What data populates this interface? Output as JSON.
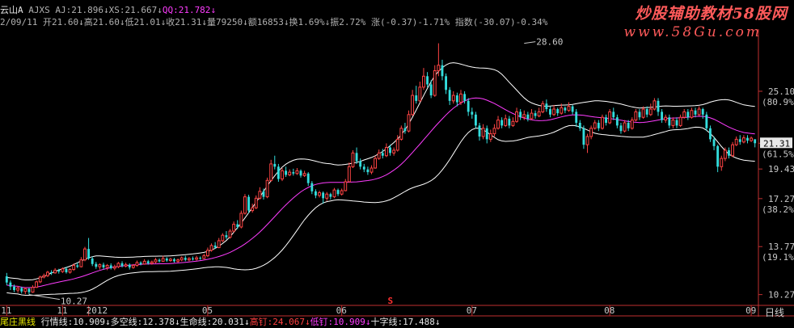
{
  "header": {
    "line1": [
      {
        "t": "云山A",
        "c": "c-white"
      },
      {
        "t": " AJXS AJ:21.896",
        "c": "c-grey"
      },
      {
        "t": "↓",
        "c": "c-grey"
      },
      {
        "t": "XS:21.667",
        "c": "c-grey"
      },
      {
        "t": "↓",
        "c": "c-grey"
      },
      {
        "t": "QQ:21.782",
        "c": "c-magenta"
      },
      {
        "t": "↓",
        "c": "c-magenta"
      }
    ],
    "line2": [
      {
        "t": "2/09/11 ",
        "c": "c-grey"
      },
      {
        "t": "开21.60",
        "c": "c-grey"
      },
      {
        "t": "↓",
        "c": "c-grey"
      },
      {
        "t": "高21.60",
        "c": "c-grey"
      },
      {
        "t": "↓",
        "c": "c-grey"
      },
      {
        "t": "低21.01",
        "c": "c-grey"
      },
      {
        "t": "↓",
        "c": "c-grey"
      },
      {
        "t": "收21.31",
        "c": "c-grey"
      },
      {
        "t": "↓",
        "c": "c-grey"
      },
      {
        "t": "量79250",
        "c": "c-grey"
      },
      {
        "t": "↓",
        "c": "c-grey"
      },
      {
        "t": "额16853",
        "c": "c-grey"
      },
      {
        "t": "↓",
        "c": "c-grey"
      },
      {
        "t": "换1.69%",
        "c": "c-grey"
      },
      {
        "t": "↓",
        "c": "c-grey"
      },
      {
        "t": "振2.72%",
        "c": "c-grey"
      },
      {
        "t": " 涨(-0.37)-1.71%",
        "c": "c-grey"
      },
      {
        "t": " 指数(-30.07)-0.34%",
        "c": "c-grey"
      }
    ]
  },
  "brand": {
    "title": "炒股辅助教材58股网",
    "url": "www.58Gu.com"
  },
  "period_label": "日线",
  "bottom_bar": [
    {
      "t": "尾庄黑线 ",
      "c": "c-yellow"
    },
    {
      "t": "行情线:10.909",
      "c": "c-white"
    },
    {
      "t": "↓",
      "c": "c-white"
    },
    {
      "t": "多空线:12.378",
      "c": "c-white"
    },
    {
      "t": "↓",
      "c": "c-white"
    },
    {
      "t": "生命线:20.031",
      "c": "c-white"
    },
    {
      "t": "↓",
      "c": "c-white"
    },
    {
      "t": "高钉:24.067",
      "c": "c-red"
    },
    {
      "t": "↓",
      "c": "c-red"
    },
    {
      "t": "低钉:10.909",
      "c": "c-magenta"
    },
    {
      "t": "↓",
      "c": "c-magenta"
    },
    {
      "t": "十字线:17.488",
      "c": "c-white"
    },
    {
      "t": "↓",
      "c": "c-white"
    }
  ],
  "colors": {
    "up": "#ff4444",
    "down": "#33dddd",
    "axis": "#c03030",
    "upper_band": "#ffffff",
    "lower_band": "#ffffff",
    "middle_band": "#ff3cff",
    "label": "#c8c8c8"
  },
  "chart_data": {
    "type": "candlestick",
    "ylim": [
      9.6,
      29.4
    ],
    "y_ticks": [
      {
        "v": 25.1,
        "label": "25.10",
        "pct": "(80.9%)"
      },
      {
        "v": 21.31,
        "label": "21.31",
        "pct": "(61.5%)",
        "current": true
      },
      {
        "v": 19.43,
        "label": "19.43",
        "pct": ""
      },
      {
        "v": 17.27,
        "label": "17.27",
        "pct": "(38.2%)"
      },
      {
        "v": 13.77,
        "label": "13.77",
        "pct": "(19.1%)"
      },
      {
        "v": 10.27,
        "label": "10.27",
        "pct": ""
      }
    ],
    "x_labels": [
      {
        "label": "11",
        "i": 0
      },
      {
        "label": "11",
        "i": 15
      },
      {
        "label": "2012",
        "i": 22
      },
      {
        "label": "05",
        "i": 54
      },
      {
        "label": "06",
        "i": 90
      },
      {
        "label": "07",
        "i": 125
      },
      {
        "label": "08",
        "i": 162
      },
      {
        "label": "09",
        "i": 200
      }
    ],
    "annotations": [
      {
        "label": "28.60",
        "i": 139,
        "price": 28.6,
        "kind": "high"
      },
      {
        "label": "10.27",
        "i": 6,
        "price": 10.27,
        "kind": "low"
      }
    ],
    "marker": {
      "label": "S",
      "i": 103
    },
    "candles": [
      [
        11.6,
        11.15,
        11.85,
        10.95
      ],
      [
        11.15,
        10.85,
        11.3,
        10.6
      ],
      [
        10.85,
        10.6,
        11.0,
        10.45
      ],
      [
        10.6,
        10.75,
        10.9,
        10.4
      ],
      [
        10.75,
        10.5,
        10.85,
        10.35
      ],
      [
        10.5,
        10.7,
        10.8,
        10.3
      ],
      [
        10.7,
        10.45,
        10.75,
        10.27
      ],
      [
        10.45,
        10.8,
        10.95,
        10.4
      ],
      [
        10.8,
        11.2,
        11.3,
        10.75
      ],
      [
        11.2,
        11.55,
        11.65,
        11.1
      ],
      [
        11.55,
        11.65,
        11.8,
        11.45
      ],
      [
        11.65,
        11.9,
        12.0,
        11.55
      ],
      [
        11.9,
        11.85,
        12.05,
        11.7
      ],
      [
        11.85,
        12.05,
        12.2,
        11.8
      ],
      [
        12.05,
        11.95,
        12.15,
        11.8
      ],
      [
        11.95,
        12.15,
        12.25,
        11.85
      ],
      [
        12.15,
        11.9,
        12.3,
        11.8
      ],
      [
        11.9,
        12.1,
        12.2,
        11.8
      ],
      [
        12.1,
        12.4,
        12.55,
        12.0
      ],
      [
        12.4,
        12.3,
        12.6,
        12.2
      ],
      [
        12.3,
        12.8,
        13.0,
        12.25
      ],
      [
        12.8,
        13.6,
        13.75,
        12.7
      ],
      [
        13.6,
        12.9,
        14.4,
        12.8
      ],
      [
        12.9,
        12.5,
        13.05,
        12.35
      ],
      [
        12.5,
        12.3,
        12.65,
        12.15
      ],
      [
        12.3,
        12.45,
        12.55,
        12.1
      ],
      [
        12.45,
        12.25,
        12.6,
        12.1
      ],
      [
        12.25,
        12.4,
        12.5,
        12.05
      ],
      [
        12.4,
        12.2,
        12.55,
        12.1
      ],
      [
        12.2,
        12.3,
        12.45,
        12.05
      ],
      [
        12.3,
        12.55,
        12.65,
        12.2
      ],
      [
        12.55,
        12.35,
        12.7,
        12.25
      ],
      [
        12.35,
        12.45,
        12.6,
        12.25
      ],
      [
        12.45,
        12.25,
        12.55,
        12.1
      ],
      [
        12.25,
        12.4,
        12.5,
        12.15
      ],
      [
        12.4,
        12.6,
        12.75,
        12.3
      ],
      [
        12.6,
        12.5,
        12.7,
        12.4
      ],
      [
        12.5,
        12.7,
        12.85,
        12.45
      ],
      [
        12.7,
        12.55,
        12.8,
        12.45
      ],
      [
        12.55,
        12.65,
        12.75,
        12.45
      ],
      [
        12.65,
        12.8,
        12.95,
        12.55
      ],
      [
        12.8,
        12.7,
        12.9,
        12.6
      ],
      [
        12.7,
        12.9,
        13.1,
        12.65
      ],
      [
        12.9,
        12.75,
        13.0,
        12.65
      ],
      [
        12.75,
        12.85,
        12.95,
        12.65
      ],
      [
        12.85,
        12.7,
        12.95,
        12.6
      ],
      [
        12.7,
        12.8,
        12.9,
        12.6
      ],
      [
        12.8,
        12.95,
        13.05,
        12.7
      ],
      [
        12.95,
        12.8,
        13.1,
        12.7
      ],
      [
        12.8,
        12.9,
        13.0,
        12.7
      ],
      [
        12.9,
        12.85,
        13.05,
        12.75
      ],
      [
        12.85,
        12.95,
        13.1,
        12.75
      ],
      [
        12.95,
        12.9,
        13.05,
        12.8
      ],
      [
        12.9,
        13.1,
        13.25,
        12.85
      ],
      [
        13.1,
        13.5,
        13.7,
        13.0
      ],
      [
        13.5,
        13.85,
        14.0,
        13.4
      ],
      [
        13.85,
        13.7,
        14.1,
        13.6
      ],
      [
        13.7,
        14.2,
        14.4,
        13.65
      ],
      [
        14.2,
        14.6,
        14.75,
        14.1
      ],
      [
        14.6,
        14.45,
        14.9,
        14.3
      ],
      [
        14.45,
        14.9,
        15.05,
        14.35
      ],
      [
        14.9,
        15.4,
        15.6,
        14.8
      ],
      [
        15.4,
        15.2,
        15.7,
        15.05
      ],
      [
        15.2,
        16.2,
        16.4,
        15.1
      ],
      [
        16.2,
        17.4,
        17.6,
        16.1
      ],
      [
        17.4,
        16.4,
        17.55,
        16.2
      ],
      [
        16.4,
        16.6,
        16.9,
        16.25
      ],
      [
        16.6,
        17.3,
        17.5,
        16.5
      ],
      [
        17.3,
        17.8,
        18.1,
        17.2
      ],
      [
        17.8,
        17.4,
        18.0,
        17.2
      ],
      [
        17.4,
        18.6,
        18.8,
        17.3
      ],
      [
        18.6,
        19.8,
        20.1,
        18.5
      ],
      [
        19.8,
        19.6,
        20.4,
        19.4
      ],
      [
        19.6,
        18.7,
        19.8,
        18.5
      ],
      [
        18.7,
        19.3,
        19.5,
        18.55
      ],
      [
        19.3,
        19.0,
        19.6,
        18.85
      ],
      [
        19.0,
        19.2,
        19.4,
        18.9
      ],
      [
        19.2,
        19.1,
        19.45,
        18.95
      ],
      [
        19.1,
        19.3,
        19.5,
        19.0
      ],
      [
        19.3,
        18.95,
        19.4,
        18.8
      ],
      [
        18.95,
        19.1,
        19.3,
        18.85
      ],
      [
        19.1,
        18.4,
        19.2,
        18.2
      ],
      [
        18.4,
        17.8,
        18.55,
        17.6
      ],
      [
        17.8,
        17.5,
        17.95,
        17.3
      ],
      [
        17.5,
        17.7,
        17.85,
        17.35
      ],
      [
        17.7,
        17.3,
        17.8,
        16.9
      ],
      [
        17.3,
        17.6,
        17.75,
        17.1
      ],
      [
        17.6,
        17.4,
        17.7,
        17.2
      ],
      [
        17.4,
        17.9,
        18.05,
        17.3
      ],
      [
        17.9,
        17.6,
        18.0,
        17.45
      ],
      [
        17.6,
        17.85,
        18.0,
        17.5
      ],
      [
        17.85,
        18.5,
        18.7,
        17.8
      ],
      [
        18.5,
        19.6,
        19.9,
        18.45
      ],
      [
        19.6,
        20.6,
        20.8,
        19.5
      ],
      [
        20.6,
        20.0,
        21.0,
        19.8
      ],
      [
        20.0,
        19.6,
        20.2,
        19.4
      ],
      [
        19.6,
        19.4,
        19.8,
        19.2
      ],
      [
        19.4,
        19.2,
        19.6,
        19.0
      ],
      [
        19.2,
        19.5,
        19.7,
        19.05
      ],
      [
        19.5,
        20.2,
        20.4,
        19.45
      ],
      [
        20.2,
        20.6,
        20.85,
        20.1
      ],
      [
        20.6,
        20.4,
        20.9,
        20.2
      ],
      [
        20.4,
        21.0,
        21.3,
        20.3
      ],
      [
        21.0,
        20.6,
        21.2,
        20.4
      ],
      [
        20.6,
        20.8,
        21.0,
        20.4
      ],
      [
        20.8,
        21.6,
        21.9,
        20.7
      ],
      [
        21.6,
        22.4,
        22.6,
        21.5
      ],
      [
        22.4,
        22.2,
        22.8,
        22.0
      ],
      [
        22.2,
        23.4,
        23.7,
        22.1
      ],
      [
        23.4,
        24.8,
        25.2,
        23.3
      ],
      [
        24.8,
        24.4,
        25.5,
        24.2
      ],
      [
        24.4,
        25.4,
        25.8,
        24.3
      ],
      [
        25.4,
        26.2,
        26.8,
        25.2
      ],
      [
        26.2,
        25.6,
        26.5,
        25.4
      ],
      [
        25.6,
        24.8,
        25.9,
        24.6
      ],
      [
        24.8,
        26.6,
        27.0,
        24.7
      ],
      [
        26.6,
        27.0,
        28.6,
        26.2
      ],
      [
        27.0,
        26.2,
        27.4,
        25.9
      ],
      [
        26.2,
        25.2,
        26.4,
        24.9
      ],
      [
        25.2,
        24.4,
        25.4,
        24.1
      ],
      [
        24.4,
        24.8,
        25.1,
        24.2
      ],
      [
        24.8,
        24.3,
        25.0,
        24.0
      ],
      [
        24.3,
        24.9,
        25.2,
        24.1
      ],
      [
        24.9,
        24.4,
        25.1,
        24.2
      ],
      [
        24.4,
        23.6,
        24.6,
        23.3
      ],
      [
        23.6,
        23.4,
        23.9,
        23.1
      ],
      [
        23.4,
        22.6,
        23.6,
        22.4
      ],
      [
        22.6,
        21.8,
        22.8,
        21.5
      ],
      [
        21.8,
        22.4,
        22.7,
        21.6
      ],
      [
        22.4,
        21.6,
        22.6,
        21.3
      ],
      [
        21.6,
        22.0,
        22.3,
        21.4
      ],
      [
        22.0,
        22.4,
        22.7,
        21.8
      ],
      [
        22.4,
        23.0,
        23.3,
        22.3
      ],
      [
        23.0,
        22.6,
        23.2,
        22.4
      ],
      [
        22.6,
        23.1,
        23.4,
        22.5
      ],
      [
        23.1,
        22.6,
        23.3,
        22.4
      ],
      [
        22.6,
        22.9,
        23.2,
        22.5
      ],
      [
        22.9,
        23.6,
        23.9,
        22.8
      ],
      [
        23.6,
        23.2,
        23.8,
        23.0
      ],
      [
        23.2,
        23.4,
        23.7,
        23.0
      ],
      [
        23.4,
        23.1,
        23.6,
        22.9
      ],
      [
        23.1,
        23.5,
        23.8,
        23.0
      ],
      [
        23.5,
        23.3,
        23.7,
        23.1
      ],
      [
        23.3,
        23.6,
        23.9,
        23.2
      ],
      [
        23.6,
        24.2,
        24.4,
        23.5
      ],
      [
        24.2,
        23.8,
        24.5,
        23.6
      ],
      [
        23.8,
        23.4,
        24.0,
        23.2
      ],
      [
        23.4,
        23.8,
        24.1,
        23.3
      ],
      [
        23.8,
        23.5,
        23.9,
        23.3
      ],
      [
        23.5,
        23.9,
        24.2,
        23.4
      ],
      [
        23.9,
        23.7,
        24.0,
        23.5
      ],
      [
        23.7,
        24.0,
        24.3,
        23.6
      ],
      [
        24.0,
        23.6,
        24.1,
        23.4
      ],
      [
        23.6,
        22.8,
        23.8,
        22.5
      ],
      [
        22.8,
        22.4,
        23.0,
        22.2
      ],
      [
        22.4,
        21.2,
        22.6,
        20.9
      ],
      [
        21.2,
        21.8,
        22.0,
        20.6
      ],
      [
        21.8,
        22.4,
        22.6,
        21.6
      ],
      [
        22.4,
        22.8,
        23.0,
        22.3
      ],
      [
        22.8,
        22.4,
        23.0,
        22.2
      ],
      [
        22.4,
        23.2,
        23.4,
        22.3
      ],
      [
        23.2,
        22.8,
        23.4,
        22.6
      ],
      [
        22.8,
        23.6,
        23.8,
        22.7
      ],
      [
        23.6,
        23.2,
        23.9,
        23.0
      ],
      [
        23.2,
        22.6,
        23.4,
        22.4
      ],
      [
        22.6,
        22.2,
        22.8,
        22.0
      ],
      [
        22.2,
        22.8,
        23.0,
        22.1
      ],
      [
        22.8,
        22.4,
        23.0,
        22.2
      ],
      [
        22.4,
        23.0,
        23.2,
        22.3
      ],
      [
        23.0,
        23.6,
        23.8,
        22.9
      ],
      [
        23.6,
        23.2,
        23.8,
        23.0
      ],
      [
        23.2,
        23.8,
        24.0,
        23.1
      ],
      [
        23.8,
        23.4,
        24.0,
        23.2
      ],
      [
        23.4,
        23.8,
        24.2,
        23.3
      ],
      [
        23.8,
        24.4,
        24.6,
        23.7
      ],
      [
        24.4,
        23.6,
        24.6,
        23.3
      ],
      [
        23.6,
        23.0,
        23.8,
        22.8
      ],
      [
        23.0,
        23.2,
        23.4,
        22.8
      ],
      [
        23.2,
        22.6,
        23.4,
        22.4
      ],
      [
        22.6,
        23.0,
        23.2,
        22.4
      ],
      [
        23.0,
        22.6,
        23.2,
        22.4
      ],
      [
        22.6,
        23.2,
        23.4,
        22.5
      ],
      [
        23.2,
        23.6,
        23.8,
        23.1
      ],
      [
        23.6,
        23.2,
        23.8,
        23.0
      ],
      [
        23.2,
        23.7,
        23.9,
        23.1
      ],
      [
        23.7,
        23.4,
        23.9,
        23.2
      ],
      [
        23.4,
        23.8,
        24.0,
        23.3
      ],
      [
        23.8,
        23.4,
        23.9,
        23.1
      ],
      [
        23.4,
        22.4,
        23.6,
        22.2
      ],
      [
        22.4,
        21.6,
        22.6,
        21.4
      ],
      [
        21.6,
        21.1,
        21.8,
        20.8
      ],
      [
        21.1,
        19.6,
        21.2,
        19.2
      ],
      [
        19.6,
        20.2,
        20.4,
        19.3
      ],
      [
        20.2,
        20.8,
        21.0,
        20.0
      ],
      [
        20.8,
        20.4,
        21.0,
        20.2
      ],
      [
        20.4,
        21.2,
        21.4,
        20.3
      ],
      [
        21.2,
        21.6,
        21.8,
        21.1
      ],
      [
        21.6,
        21.4,
        21.9,
        21.2
      ],
      [
        21.4,
        21.7,
        21.9,
        21.3
      ],
      [
        21.7,
        21.5,
        21.9,
        21.3
      ],
      [
        21.5,
        21.68,
        21.8,
        21.4
      ],
      [
        21.6,
        21.31,
        21.6,
        21.01
      ]
    ]
  }
}
